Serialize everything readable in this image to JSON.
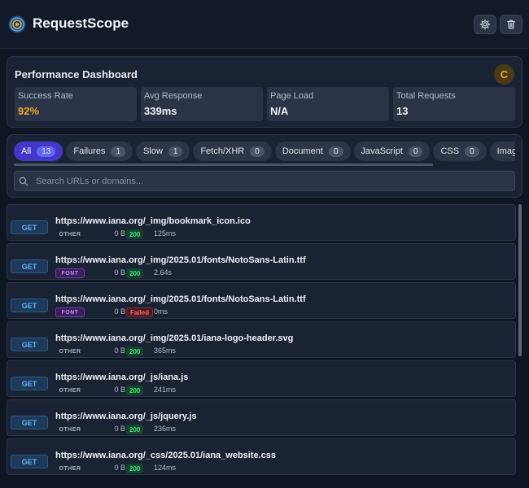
{
  "app": {
    "title": "RequestScope"
  },
  "performance": {
    "title": "Performance Dashboard",
    "grade": "C",
    "stats": [
      {
        "label": "Success Rate",
        "value": "92%"
      },
      {
        "label": "Avg Response",
        "value": "339ms"
      },
      {
        "label": "Page Load",
        "value": "N/A"
      },
      {
        "label": "Total Requests",
        "value": "13"
      }
    ]
  },
  "filters": [
    {
      "label": "All",
      "count": "13"
    },
    {
      "label": "Failures",
      "count": "1"
    },
    {
      "label": "Slow",
      "count": "1"
    },
    {
      "label": "Fetch/XHR",
      "count": "0"
    },
    {
      "label": "Document",
      "count": "0"
    },
    {
      "label": "JavaScript",
      "count": "0"
    },
    {
      "label": "CSS",
      "count": "0"
    },
    {
      "label": "Images",
      "count": ""
    }
  ],
  "search": {
    "placeholder": "Search URLs or domains..."
  },
  "requests": [
    {
      "method": "GET",
      "url": "https://www.iana.org/_img/bookmark_icon.ico",
      "type": "OTHER",
      "size": "0 B",
      "status": "200",
      "time": "125ms"
    },
    {
      "method": "GET",
      "url": "https://www.iana.org/_img/2025.01/fonts/NotoSans-Latin.ttf",
      "type": "FONT",
      "size": "0 B",
      "status": "200",
      "time": "2.64s"
    },
    {
      "method": "GET",
      "url": "https://www.iana.org/_img/2025.01/fonts/NotoSans-Latin.ttf",
      "type": "FONT",
      "size": "0 B",
      "status": "Failed",
      "time": "0ms"
    },
    {
      "method": "GET",
      "url": "https://www.iana.org/_img/2025.01/iana-logo-header.svg",
      "type": "OTHER",
      "size": "0 B",
      "status": "200",
      "time": "365ms"
    },
    {
      "method": "GET",
      "url": "https://www.iana.org/_js/iana.js",
      "type": "OTHER",
      "size": "0 B",
      "status": "200",
      "time": "241ms"
    },
    {
      "method": "GET",
      "url": "https://www.iana.org/_js/jquery.js",
      "type": "OTHER",
      "size": "0 B",
      "status": "200",
      "time": "236ms"
    },
    {
      "method": "GET",
      "url": "https://www.iana.org/_css/2025.01/iana_website.css",
      "type": "OTHER",
      "size": "0 B",
      "status": "200",
      "time": "124ms"
    }
  ],
  "colors": {
    "accent": "#4338ca",
    "warning": "#f0a92d",
    "success": "#4ade80",
    "error": "#f16d72"
  }
}
